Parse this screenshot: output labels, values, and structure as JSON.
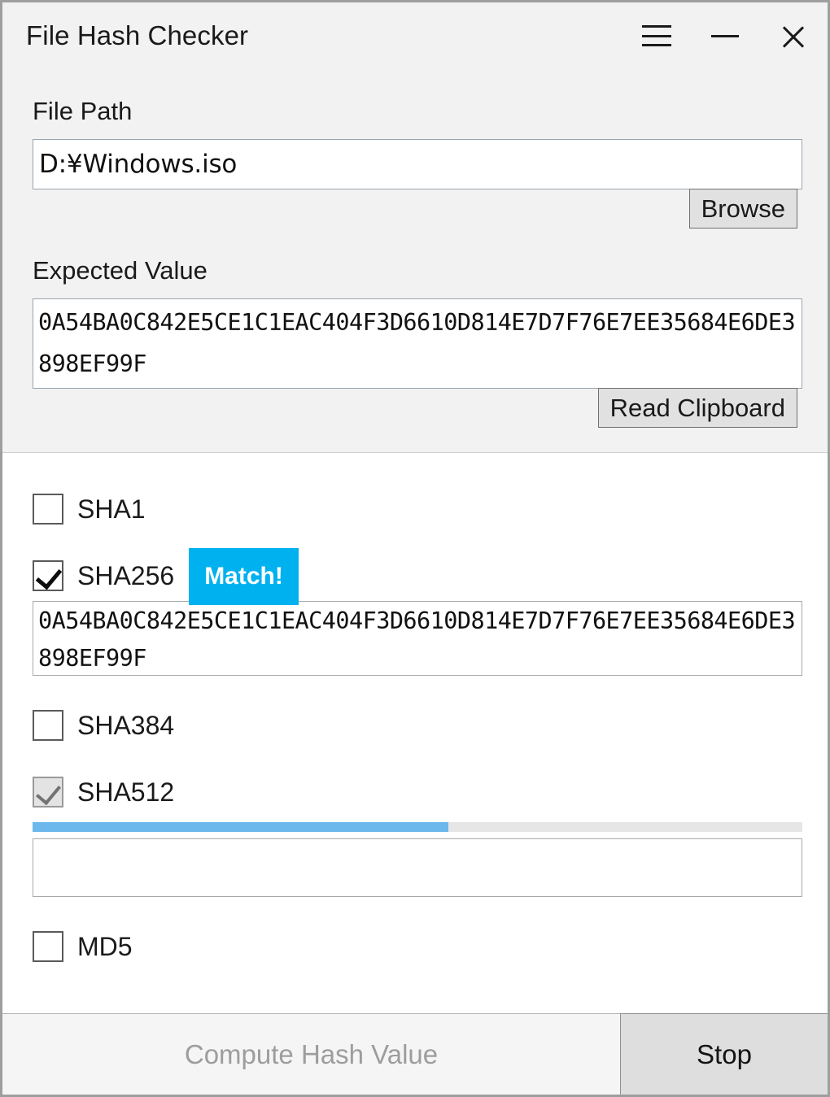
{
  "window": {
    "title": "File Hash Checker",
    "caption_buttons": [
      {
        "name": "menu",
        "icon": "hamburger-icon"
      },
      {
        "name": "minimize",
        "icon": "minimize-icon"
      },
      {
        "name": "close",
        "icon": "close-icon"
      }
    ]
  },
  "form": {
    "file_path_label": "File Path",
    "file_path_value": "D:¥Windows.iso",
    "file_path_placeholder": "",
    "browse_label": "Browse",
    "expected_value_label": "Expected Value",
    "expected_value": "0A54BA0C842E5CE1C1EAC404F3D6610D814E7D7F76E7EE35684E6DE3898EF99F",
    "expected_value_placeholder": "",
    "read_clipboard_label": "Read Clipboard"
  },
  "algorithms": {
    "sha1": {
      "label": "SHA1",
      "checked": false,
      "disabled": false
    },
    "sha256": {
      "label": "SHA256",
      "checked": true,
      "disabled": false,
      "badge": "Match!",
      "badge_color": "#00b1f0",
      "result": "0A54BA0C842E5CE1C1EAC404F3D6610D814E7D7F76E7EE35684E6DE3898EF99F"
    },
    "sha384": {
      "label": "SHA384",
      "checked": false,
      "disabled": false
    },
    "sha512": {
      "label": "SHA512",
      "checked": true,
      "disabled": true,
      "progress_percent": 54,
      "progress_color": "#6cb8ec",
      "result": ""
    },
    "md5": {
      "label": "MD5",
      "checked": false,
      "disabled": false
    }
  },
  "actions": {
    "compute_label": "Compute Hash Value",
    "compute_enabled": false,
    "stop_label": "Stop",
    "stop_enabled": true
  }
}
